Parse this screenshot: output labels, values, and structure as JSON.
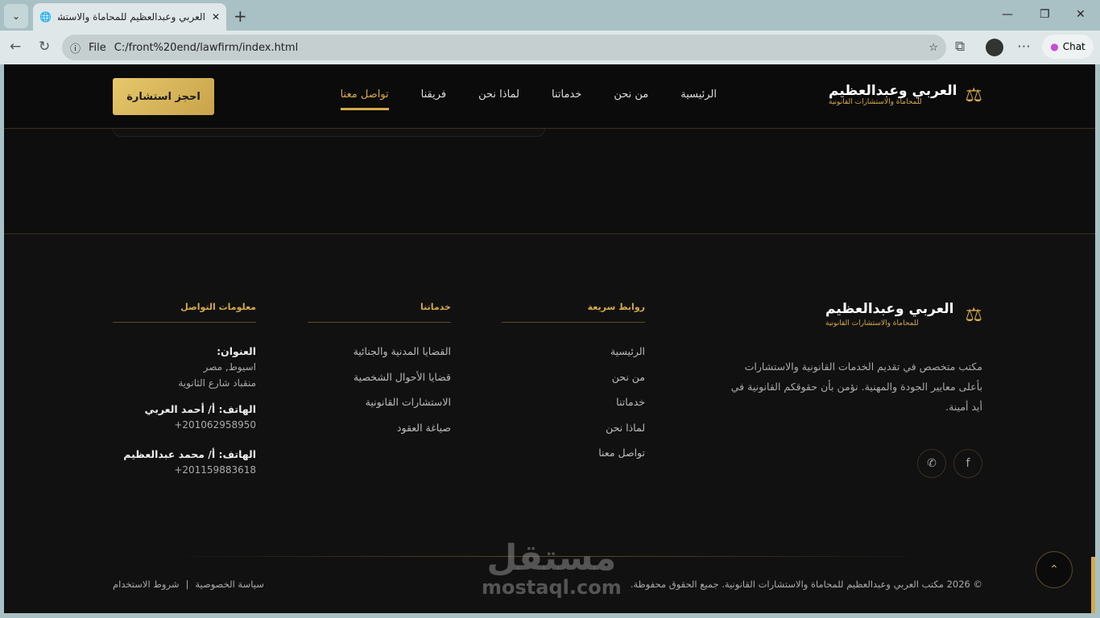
{
  "browser": {
    "tab_title": "العربي وعبدالعظيم للمحاماة والاستشارات",
    "url_scheme": "File",
    "url": "C:/front%20end/lawfirm/index.html",
    "chat_label": "Chat"
  },
  "header": {
    "brand_name": "العربي وعبدالعظيم",
    "brand_sub": "للمحاماة والاستشارات القانونية",
    "nav": [
      "الرئيسية",
      "من نحن",
      "خدماتنا",
      "لماذا نحن",
      "فريقنا",
      "تواصل معنا"
    ],
    "active_nav": "تواصل معنا",
    "cta": "احجز استشارة"
  },
  "footer": {
    "brand_name": "العربي وعبدالعظيم",
    "brand_sub": "للمحاماة والاستشارات القانونية",
    "description": "مكتب متخصص في تقديم الخدمات القانونية والاستشارات بأعلى معايير الجودة والمهنية. نؤمن بأن حقوقكم القانونية في أيد أمينة.",
    "quick_links": {
      "title": "روابط سريعة",
      "items": [
        "الرئيسية",
        "من نحن",
        "خدماتنا",
        "لماذا نحن",
        "تواصل معنا"
      ]
    },
    "services": {
      "title": "خدماتنا",
      "items": [
        "القضايا المدنية والجنائية",
        "قضايا الأحوال الشخصية",
        "الاستشارات القانونية",
        "صياغة العقود"
      ]
    },
    "contact": {
      "title": "معلومات التواصل",
      "address_label": "العنوان:",
      "address_1": "اسيوط, مصر",
      "address_2": "منقباد شارع الثانوية",
      "phone1_label": "الهاتف: أ/ أحمد العربي",
      "phone1": "+201062958950",
      "phone2_label": "الهاتف: أ/ محمد عبدالعظيم",
      "phone2": "+201159883618"
    },
    "copyright": "© 2026 مكتب العربي وعبدالعظيم للمحاماة والاستشارات القانونية. جميع الحقوق محفوظة.",
    "privacy": "سياسة الخصوصية",
    "separator": "|",
    "terms": "شروط الاستخدام"
  },
  "watermark": {
    "ar": "مستقل",
    "en": "mostaql.com"
  },
  "colors": {
    "gold": "#d4aa4a",
    "bg": "#111111"
  }
}
